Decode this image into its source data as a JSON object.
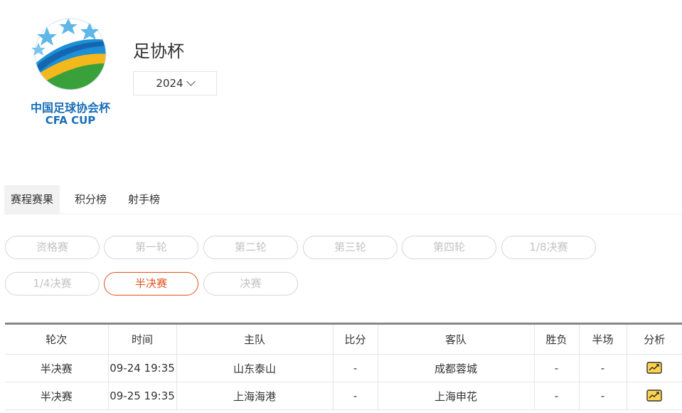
{
  "logo": {
    "cn_text": "中国足球协会杯",
    "en_text": "CFA CUP"
  },
  "competition": {
    "title": "足协杯",
    "season": "2024"
  },
  "tabs": [
    {
      "label": "赛程赛果",
      "active": true
    },
    {
      "label": "积分榜",
      "active": false
    },
    {
      "label": "射手榜",
      "active": false
    }
  ],
  "rounds": [
    {
      "label": "资格赛",
      "active": false
    },
    {
      "label": "第一轮",
      "active": false
    },
    {
      "label": "第二轮",
      "active": false
    },
    {
      "label": "第三轮",
      "active": false
    },
    {
      "label": "第四轮",
      "active": false
    },
    {
      "label": "1/8决赛",
      "active": false
    },
    {
      "label": "1/4决赛",
      "active": false
    },
    {
      "label": "半决赛",
      "active": true
    },
    {
      "label": "决赛",
      "active": false
    }
  ],
  "table": {
    "headers": [
      "轮次",
      "时间",
      "主队",
      "比分",
      "客队",
      "胜负",
      "半场",
      "分析"
    ],
    "rows": [
      {
        "round": "半决赛",
        "time": "09-24 19:35",
        "home": "山东泰山",
        "score": "-",
        "away": "成都蓉城",
        "result": "-",
        "half": "-",
        "analysis_icon": "analysis-chart-icon"
      },
      {
        "round": "半决赛",
        "time": "09-25 19:35",
        "home": "上海海港",
        "score": "-",
        "away": "上海申花",
        "result": "-",
        "half": "-",
        "analysis_icon": "analysis-chart-icon"
      }
    ]
  },
  "colors": {
    "accent": "#e0531e",
    "inactive_round": "#c3c3c3",
    "logo_blue": "#1a6fb8"
  }
}
